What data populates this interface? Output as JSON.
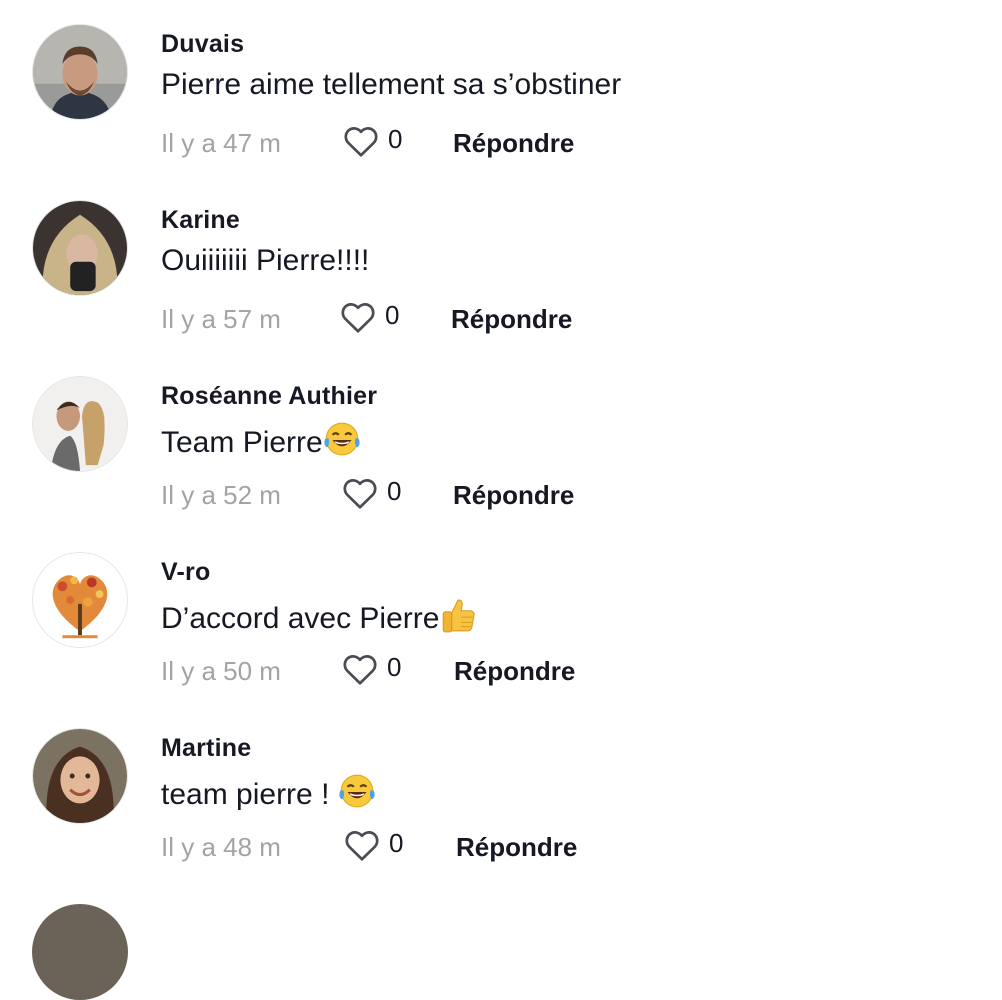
{
  "comments": [
    {
      "user": "Duvais",
      "text": "Pierre aime tellement sa s’obstiner",
      "time": "Il y a 47 m",
      "likes": "0",
      "reply": "Répondre",
      "avatar": "avatar-duvais"
    },
    {
      "user": "Karine",
      "text": "Ouiiiiiii Pierre!!!!",
      "time": "Il y a 57 m",
      "likes": "0",
      "reply": "Répondre",
      "avatar": "avatar-karine"
    },
    {
      "user": "Roséanne Authier",
      "text": "Team Pierre",
      "emoji": "laughing-tears-emoji",
      "time": "Il y a 52 m",
      "likes": "0",
      "reply": "Répondre",
      "avatar": "avatar-roseanne"
    },
    {
      "user": "V-ro",
      "text": "D’accord avec Pierre",
      "emoji": "thumbs-up-emoji",
      "time": "Il y a 50 m",
      "likes": "0",
      "reply": "Répondre",
      "avatar": "avatar-vro"
    },
    {
      "user": "Martine",
      "text": "team pierre ! ",
      "emoji": "laughing-tears-emoji",
      "time": "Il y a 48 m",
      "likes": "0",
      "reply": "Répondre",
      "avatar": "avatar-martine"
    }
  ],
  "colors": {
    "text": "#161823",
    "muted": "#a3a3a8",
    "background": "#ffffff"
  },
  "icons": {
    "like": "heart-outline-icon"
  }
}
